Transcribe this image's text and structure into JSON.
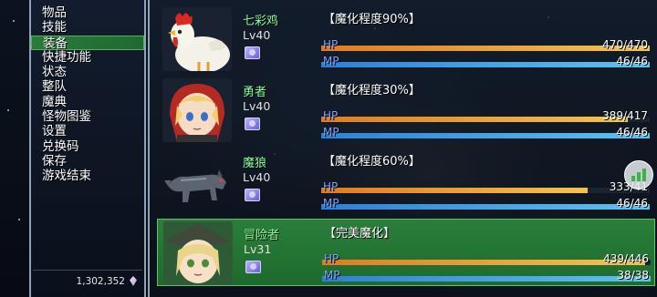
{
  "menu": {
    "items": [
      {
        "label": "物品"
      },
      {
        "label": "技能"
      },
      {
        "label": "装备",
        "selected": true
      },
      {
        "label": "快捷功能"
      },
      {
        "label": "状态"
      },
      {
        "label": "整队"
      },
      {
        "label": "魔典"
      },
      {
        "label": "怪物图鉴"
      },
      {
        "label": "设置"
      },
      {
        "label": "兑换码"
      },
      {
        "label": "保存"
      },
      {
        "label": "游戏结束"
      }
    ],
    "gold": "1,302,352",
    "gold_icon": "crystal-icon"
  },
  "party": [
    {
      "name": "七彩鸡",
      "lv_label": "Lv",
      "level": "40",
      "status": "【魔化程度90%】",
      "hp_label": "HP",
      "hp": "470/470",
      "hp_ratio": 1.0,
      "mp_label": "MP",
      "mp": "46/46",
      "mp_ratio": 1.0,
      "portrait": "rooster"
    },
    {
      "name": "勇者",
      "lv_label": "Lv",
      "level": "40",
      "status": "【魔化程度30%】",
      "hp_label": "HP",
      "hp": "389/417",
      "hp_ratio": 0.933,
      "mp_label": "MP",
      "mp": "46/46",
      "mp_ratio": 1.0,
      "portrait": "hero"
    },
    {
      "name": "魔狼",
      "lv_label": "Lv",
      "level": "40",
      "status": "【魔化程度60%】",
      "hp_label": "HP",
      "hp": "333/41",
      "hp_ratio": 0.81,
      "mp_label": "MP",
      "mp": "46/46",
      "mp_ratio": 1.0,
      "portrait": "wolf"
    },
    {
      "name": "冒险者",
      "lv_label": "Lv",
      "level": "31",
      "status": "【完美魔化】",
      "hp_label": "HP",
      "hp": "439/446",
      "hp_ratio": 0.984,
      "mp_label": "MP",
      "mp": "38/38",
      "mp_ratio": 1.0,
      "portrait": "adventurer",
      "selected": true
    }
  ],
  "colors": {
    "name": "#8cff9e",
    "hp_fill": "#f1c552",
    "mp_fill": "#5fc2ef",
    "selected": "#2a7e3a"
  },
  "overlay": {
    "stats_icon": "bar-chart-icon"
  }
}
